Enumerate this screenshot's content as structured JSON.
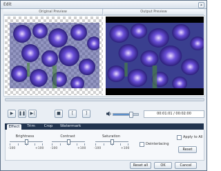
{
  "window": {
    "title": "Edit",
    "close_label": "x"
  },
  "preview": {
    "original_label": "Original Preview",
    "output_label": "Output Preview"
  },
  "playback": {
    "progress": 0.0,
    "controls": [
      {
        "name": "play-button",
        "glyph": "▶"
      },
      {
        "name": "pause-button",
        "glyph": "❚❚"
      },
      {
        "name": "next-frame-button",
        "glyph": "▶|"
      },
      {
        "name": "stop-button",
        "glyph": "■"
      },
      {
        "name": "mark-in-button",
        "glyph": "["
      },
      {
        "name": "mark-out-button",
        "glyph": "]"
      }
    ],
    "volume": 0.7,
    "timecode": "00:01:01 / 00:02:00"
  },
  "tabs": [
    {
      "label": "Effect",
      "active": true
    },
    {
      "label": "Trim",
      "active": false
    },
    {
      "label": "Crop",
      "active": false
    },
    {
      "label": "Watermark",
      "active": false
    }
  ],
  "effect": {
    "sliders": [
      {
        "label": "Brightness",
        "min": "-100",
        "max": "+100",
        "value": 0
      },
      {
        "label": "Contrast",
        "min": "-100",
        "max": "+100",
        "value": 0
      },
      {
        "label": "Saturation",
        "min": "-100",
        "max": "+100",
        "value": 0
      }
    ],
    "deinterlacing_label": "Deinterlacing",
    "apply_all_label": "Apply to All",
    "reset_label": "Reset"
  },
  "footer": {
    "reset_all_label": "Reset all",
    "ok_label": "OK",
    "cancel_label": "Cancel"
  },
  "colors": {
    "tabbar": "#21344f",
    "accent": "#7aa6d6"
  }
}
